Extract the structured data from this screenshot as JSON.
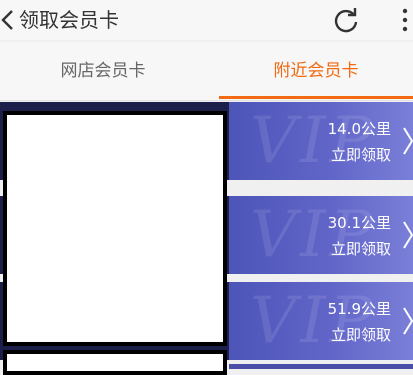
{
  "header": {
    "title": "领取会员卡"
  },
  "tabs": [
    {
      "label": "网店会员卡"
    },
    {
      "label": "附近会员卡"
    }
  ],
  "cards": [
    {
      "distance": "14.0公里",
      "action": "立即领取"
    },
    {
      "distance": "30.1公里",
      "action": "立即领取"
    },
    {
      "distance": "51.9公里",
      "action": "立即领取"
    }
  ],
  "watermark": "VIP",
  "colors": {
    "accent": "#f26a12",
    "card_start": "#4d55b8",
    "card_end": "#7a7fd8"
  },
  "icons": [
    "chevron-left-icon",
    "refresh-icon",
    "more-vertical-icon",
    "chevron-right-icon"
  ]
}
